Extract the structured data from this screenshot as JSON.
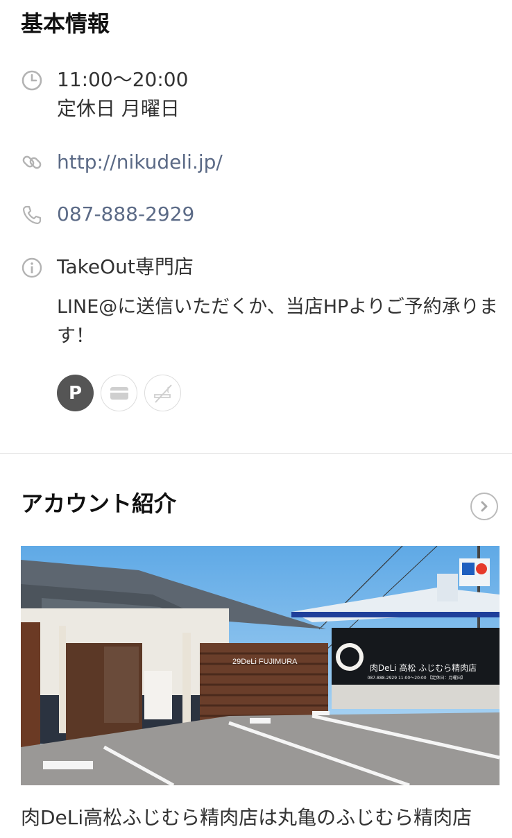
{
  "basic_info": {
    "title": "基本情報",
    "hours": "11:00〜20:00",
    "holiday": "定休日 月曜日",
    "website": "http://nikudeli.jp/",
    "phone": "087-888-2929",
    "info_title": "TakeOut専門店",
    "info_desc": "LINE@に送信いただくか、当店HPよりご予約承ります！",
    "badges": [
      {
        "name": "parking",
        "label": "P",
        "active": true
      },
      {
        "name": "credit-card",
        "active": false
      },
      {
        "name": "no-smoking",
        "active": false
      }
    ]
  },
  "account": {
    "title": "アカウント紹介",
    "photo_sign_text": "29DeLi FUJIMURA",
    "photo_signboard": "肉DeLi 高松 ふじむら精肉店",
    "photo_signboard_sub": "087-888-2929  11:00〜20:00 【定休日：月曜日】",
    "caption": "肉DeLi高松ふじむら精肉店は丸亀のふじむら精肉店"
  },
  "colors": {
    "link": "#5b6a86",
    "icon": "#b3b3b3",
    "badge_active": "#555555"
  }
}
